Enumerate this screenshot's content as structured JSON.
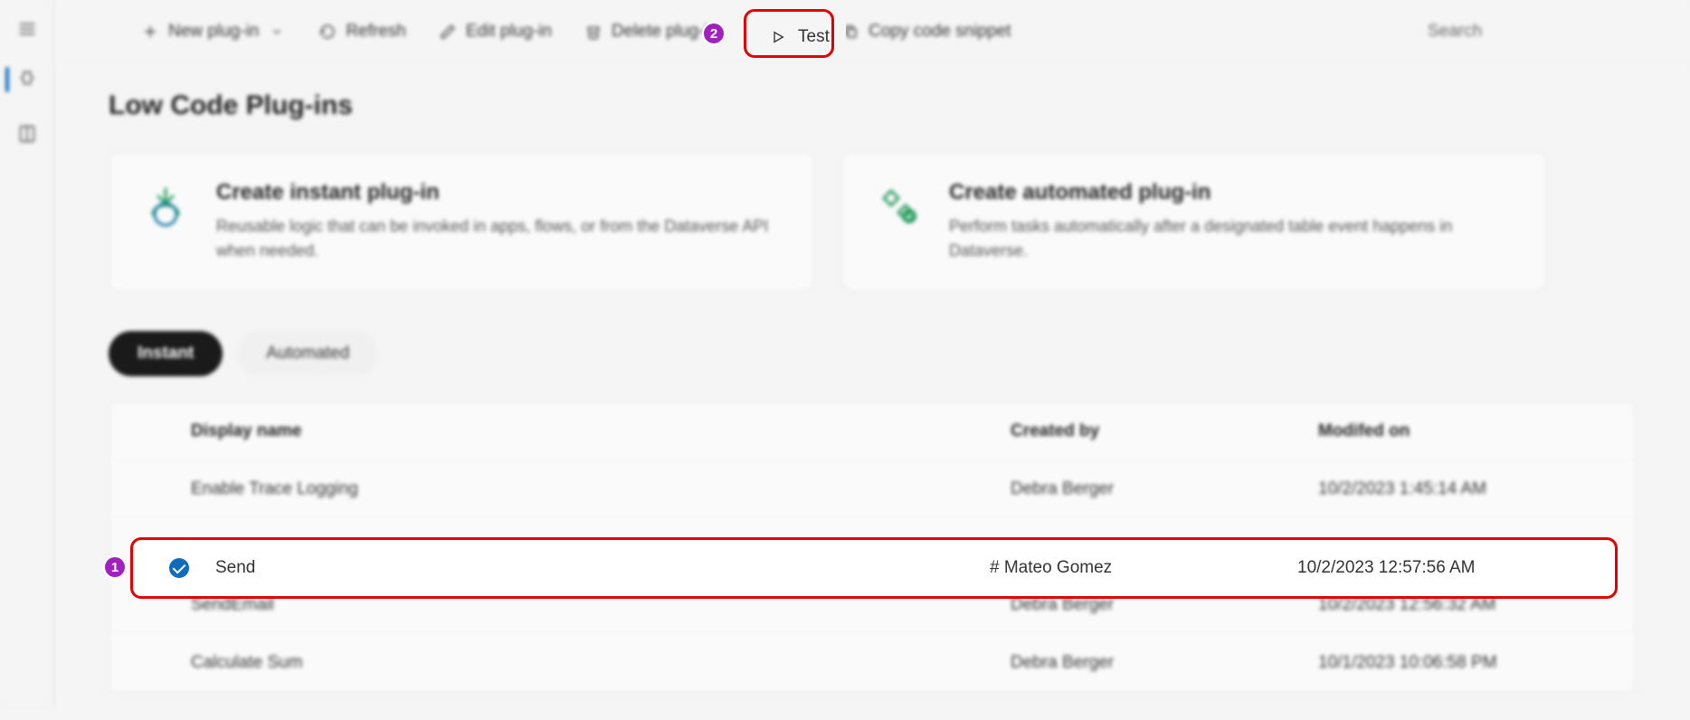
{
  "toolbar": {
    "new_plugin": "New plug-in",
    "refresh": "Refresh",
    "edit": "Edit plug-in",
    "delete": "Delete plug-in",
    "test": "Test",
    "copy": "Copy code snippet",
    "search_placeholder": "Search"
  },
  "page": {
    "title": "Low Code Plug-ins"
  },
  "cards": {
    "instant": {
      "title": "Create instant plug-in",
      "desc": "Reusable logic that can be invoked in apps, flows, or from the Dataverse API when needed."
    },
    "automated": {
      "title": "Create automated plug-in",
      "desc": "Perform tasks automatically after a designated table event happens in Dataverse."
    }
  },
  "tabs": {
    "instant": "Instant",
    "automated": "Automated"
  },
  "table": {
    "headers": {
      "display_name": "Display name",
      "created_by": "Created by",
      "modified_on": "Modifed on"
    },
    "rows": [
      {
        "name": "Enable Trace Logging",
        "by": "Debra Berger",
        "on": "10/2/2023 1:45:14 AM",
        "selected": false
      },
      {
        "name": "Send",
        "by": "# Mateo Gomez",
        "on": "10/2/2023 12:57:56 AM",
        "selected": true
      },
      {
        "name": "SendEmail",
        "by": "Debra Berger",
        "on": "10/2/2023 12:56:32 AM",
        "selected": false
      },
      {
        "name": "Calculate Sum",
        "by": "Debra Berger",
        "on": "10/1/2023 10:06:58 PM",
        "selected": false
      }
    ]
  },
  "callouts": {
    "one": "1",
    "two": "2"
  }
}
